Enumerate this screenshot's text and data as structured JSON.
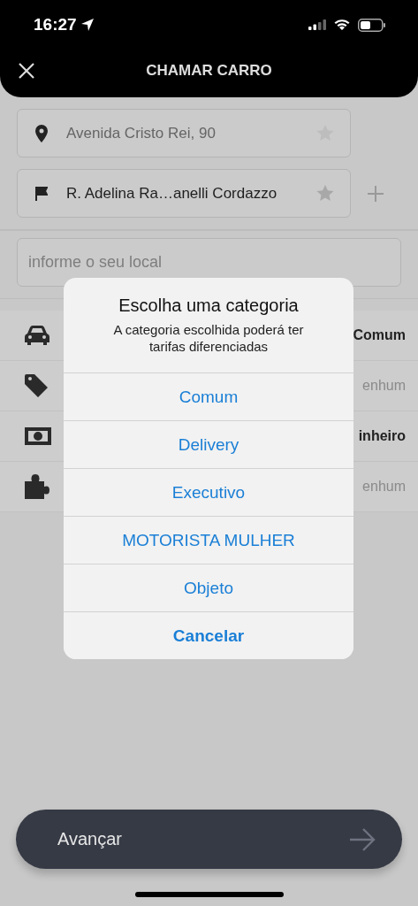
{
  "status_bar": {
    "time": "16:27"
  },
  "header": {
    "title": "CHAMAR CARRO"
  },
  "route": [
    {
      "kind": "origin",
      "address": "Avenida Cristo Rei, 90"
    },
    {
      "kind": "destination",
      "address": "R. Adelina Ra…anelli Cordazzo"
    }
  ],
  "search": {
    "placeholder": "informe o seu local"
  },
  "options": [
    {
      "kind": "category",
      "value": "Comum",
      "muted": false
    },
    {
      "kind": "coupon",
      "value": "enhum",
      "muted": true
    },
    {
      "kind": "payment",
      "value": "inheiro",
      "muted": false
    },
    {
      "kind": "extras",
      "value": "enhum",
      "muted": true
    }
  ],
  "dialog": {
    "title": "Escolha uma categoria",
    "message": "A categoria escolhida poderá ter tarifas diferenciadas",
    "options": [
      "Comum",
      "Delivery",
      "Executivo",
      "MOTORISTA MULHER",
      "Objeto"
    ],
    "cancel": "Cancelar"
  },
  "next_button": {
    "label": "Avançar"
  }
}
